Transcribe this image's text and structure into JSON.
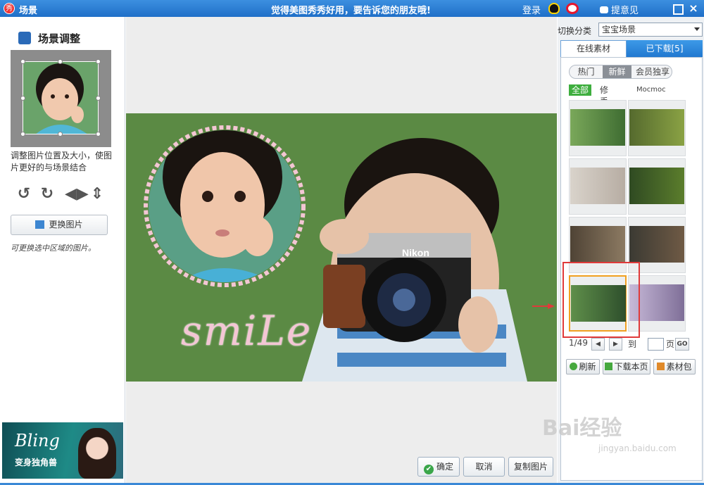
{
  "titlebar": {
    "app_logo": "秀",
    "title": "场景",
    "slogan": "觉得美图秀秀好用，要告诉您的朋友哦!",
    "login": "登录",
    "feedback": "提意见",
    "close": "×"
  },
  "left_panel": {
    "header": "场景调整",
    "description": "调整图片位置及大小，使图片更好的与场景结合",
    "tools": [
      "rotate-left-icon",
      "rotate-right-icon",
      "flip-horizontal-icon",
      "flip-vertical-icon"
    ],
    "change_button": "更换图片",
    "hint": "可更换选中区域的图片。",
    "ad": {
      "title": "Bling",
      "subtitle": "变身独角兽"
    }
  },
  "canvas": {
    "overlay_text": "smiLe",
    "confirm": "确定",
    "cancel": "取消",
    "copy": "复制图片"
  },
  "right_panel": {
    "switch_label": "切换分类",
    "category": "宝宝场景",
    "tabs": {
      "online": "在线素材",
      "downloaded": "已下载[5]"
    },
    "filters": [
      "热门",
      "新鲜",
      "会员独享"
    ],
    "active_filter": "新鲜",
    "sources": {
      "all": "全部",
      "src1": "修丢丢",
      "src2": "Mocmoc"
    },
    "pager": {
      "page": "1/49",
      "prev": "◀",
      "next": "▶",
      "to": "到",
      "page_unit": "页",
      "go": "GO"
    },
    "actions": {
      "refresh": "刷新",
      "download_page": "下载本页",
      "pack": "素材包"
    }
  },
  "watermark": {
    "main": "Bai经验",
    "sub": "jingyan.baidu.com"
  },
  "colors": {
    "titlebar": "#2a7fd8",
    "accent_green": "#3eae3e",
    "highlight_red": "#e03a3a",
    "selected_orange": "#f0a020"
  }
}
